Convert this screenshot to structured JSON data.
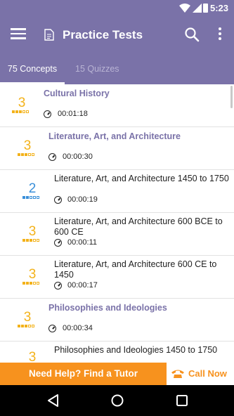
{
  "status_bar": {
    "time": "5:23"
  },
  "app_bar": {
    "title": "Practice Tests"
  },
  "tabs": [
    {
      "label": "75 Concepts",
      "active": true
    },
    {
      "label": "15 Quizzes",
      "active": false
    }
  ],
  "rows": [
    {
      "score": "3",
      "level_of_5": 3,
      "title": "Cultural History",
      "duration": "00:01:18"
    },
    {
      "score": "3",
      "level_of_5": 3,
      "title": "Literature, Art, and Architecture",
      "duration": "00:00:30"
    },
    {
      "score": "2",
      "level_of_5": 2,
      "title": "Literature, Art, and Architecture 1450 to 1750",
      "duration": "00:00:19"
    },
    {
      "score": "3",
      "level_of_5": 3,
      "title": "Literature, Art, and Architecture 600 BCE to 600 CE",
      "duration": "00:00:11"
    },
    {
      "score": "3",
      "level_of_5": 3,
      "title": "Literature, Art, and Architecture 600 CE to 1450",
      "duration": "00:00:17"
    },
    {
      "score": "3",
      "level_of_5": 3,
      "title": "Philosophies and Ideologies",
      "duration": "00:00:34"
    },
    {
      "score": "3",
      "level_of_5": 3,
      "title": "Philosophies and Ideologies 1450 to 1750",
      "duration": ""
    }
  ],
  "help_bar": {
    "text": "Need Help? Find a Tutor",
    "call_label": "Call Now"
  },
  "colors": {
    "header": "#7a72a8",
    "accent_orange": "#f7921e",
    "score_yellow": "#f3b21a",
    "score_blue": "#3a8fd9"
  },
  "icons": [
    "menu-icon",
    "document-icon",
    "search-icon",
    "more-icon",
    "clock-icon",
    "phone-icon",
    "back-icon",
    "home-icon",
    "recents-icon",
    "wifi-icon",
    "signal-icon",
    "battery-icon"
  ]
}
